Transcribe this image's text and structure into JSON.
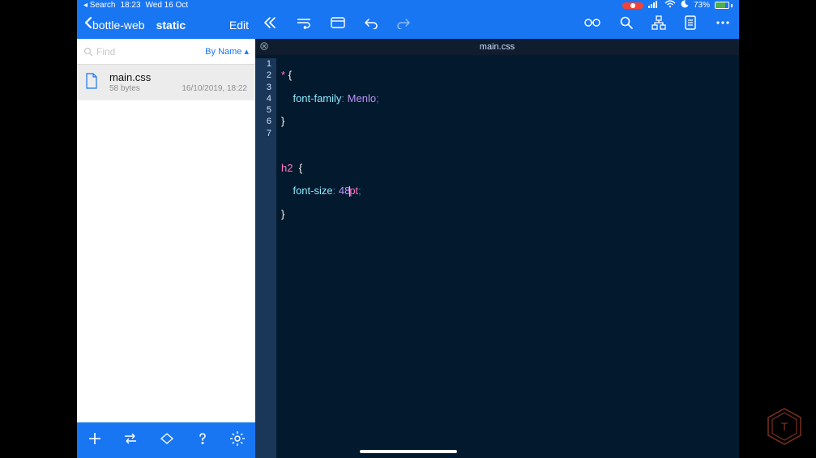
{
  "status": {
    "back_app": "◂ Search",
    "time": "18:23",
    "date": "Wed 16 Oct",
    "battery_pct": "73%"
  },
  "sidebar": {
    "back_label": "bottle-web",
    "title": "static",
    "edit": "Edit",
    "find_placeholder": "Find",
    "sort_label": "By Name ▴",
    "files": [
      {
        "name": "main.css",
        "size": "58 bytes",
        "date": "16/10/2019, 18:22"
      }
    ]
  },
  "editor": {
    "tab_name": "main.css",
    "lines": [
      "1",
      "2",
      "3",
      "4",
      "5",
      "6",
      "7"
    ],
    "code": {
      "l1_sel": "*",
      "l1_brace": "{",
      "l2_prop": "font-family",
      "l2_val": "Menlo",
      "l3_brace": "}",
      "l5_sel": "h2",
      "l5_brace": "{",
      "l6_prop": "font-size",
      "l6_num": "48",
      "l6_unit": "pt",
      "l7_brace": "}"
    }
  }
}
